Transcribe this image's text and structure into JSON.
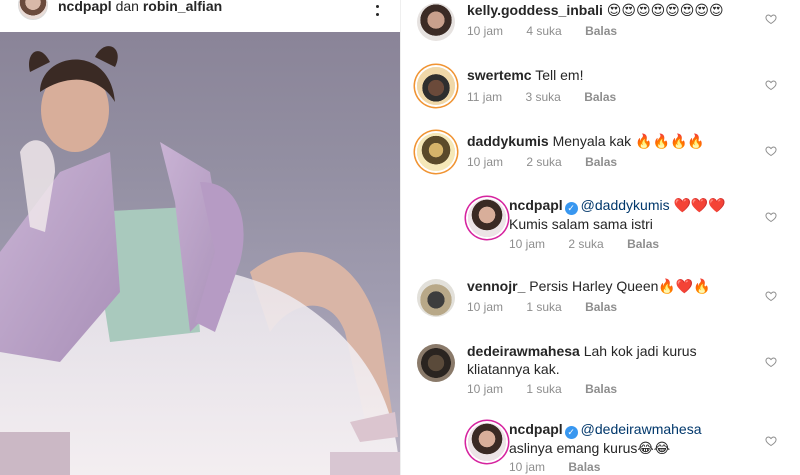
{
  "post": {
    "owner": "ncdpapl",
    "connector": "dan",
    "collaborator": "robin_alfian"
  },
  "comments": [
    {
      "user": "kelly.goddess_inbali",
      "text": "😍😍😍😍😍😍😍😍",
      "time": "10 jam",
      "likes": "4 suka",
      "reply": "Balas",
      "verified": false
    },
    {
      "user": "swertemc",
      "text": "Tell em!",
      "time": "11 jam",
      "likes": "3 suka",
      "reply": "Balas",
      "verified": false
    },
    {
      "user": "daddykumis",
      "text": "Menyala kak 🔥🔥🔥🔥",
      "time": "10 jam",
      "likes": "2 suka",
      "reply": "Balas",
      "verified": false
    },
    {
      "user": "ncdpapl",
      "mention": "@daddykumis",
      "text": "❤️❤️❤️",
      "text2": "Kumis salam sama istri",
      "time": "10 jam",
      "likes": "2 suka",
      "reply": "Balas",
      "verified": true
    },
    {
      "user": "vennojr_",
      "text": "Persis Harley Queen🔥❤️🔥",
      "time": "10 jam",
      "likes": "1 suka",
      "reply": "Balas",
      "verified": false
    },
    {
      "user": "dedeirawmahesa",
      "text": "Lah kok jadi kurus kliatannya kak.",
      "time": "10 jam",
      "likes": "1 suka",
      "reply": "Balas",
      "verified": false
    },
    {
      "user": "ncdpapl",
      "mention": "@dedeirawmahesa",
      "text": "",
      "text2": "aslinya emang kurus😂😂",
      "time": "10 jam",
      "likes": "",
      "reply": "Balas",
      "verified": true
    }
  ],
  "icons": {
    "more": "more-options-icon",
    "heart": "heart-outline-icon",
    "verified": "verified-badge-icon"
  },
  "colors": {
    "text": "#262626",
    "meta": "#8e8e8e",
    "mention": "#00376b",
    "verified": "#3897f0"
  }
}
